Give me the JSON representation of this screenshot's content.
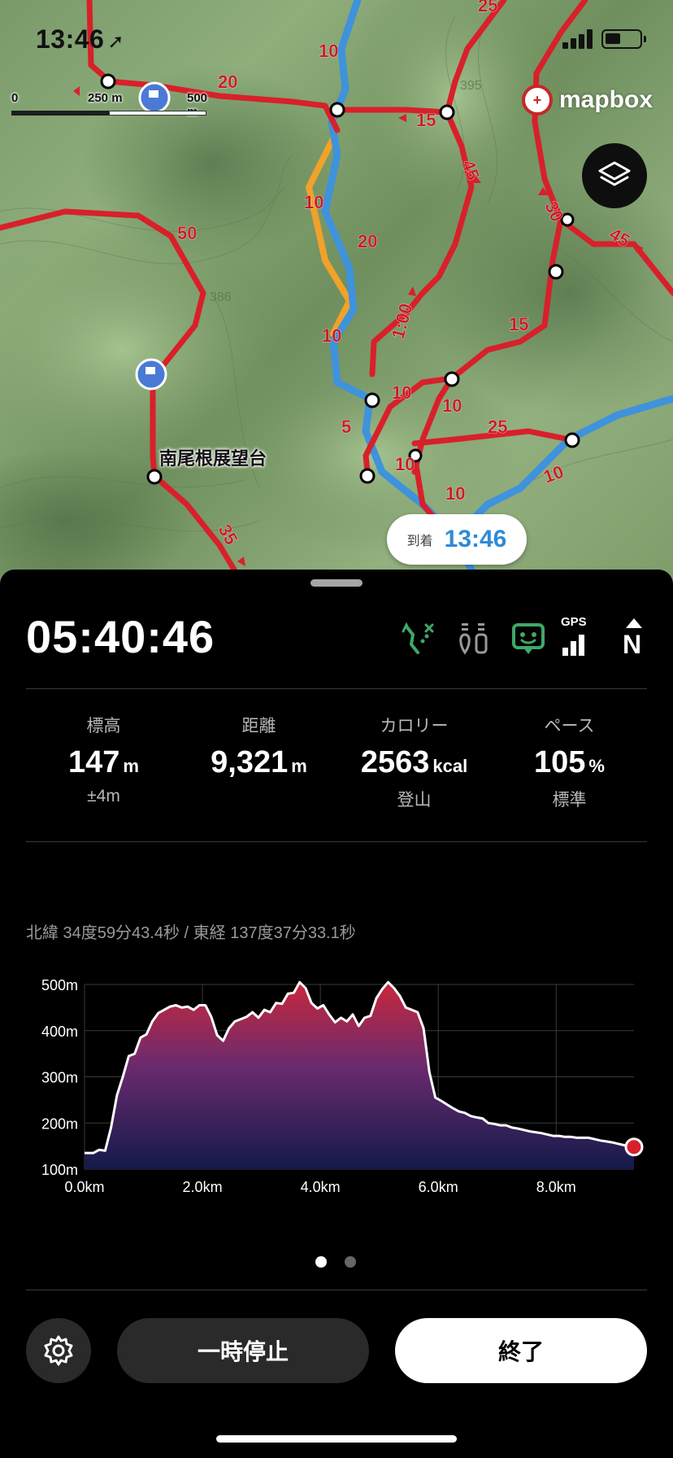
{
  "status_bar": {
    "time": "13:46"
  },
  "map": {
    "scale_labels": [
      "0",
      "250 m",
      "500 m"
    ],
    "brand": "mapbox",
    "place_name": "南尾根展望台",
    "arrival_label": "到着",
    "arrival_time": "13:46",
    "trail_times": [
      "25",
      "10",
      "20",
      "15",
      "45",
      "30",
      "45",
      "50",
      "10",
      "20",
      "1:00",
      "15",
      "10",
      "10",
      "5",
      "25",
      "10",
      "10",
      "10",
      "35",
      "10"
    ],
    "elevation_marks": [
      "395",
      "386"
    ],
    "colors": {
      "trail": "#d8202b",
      "river": "#3f92dc",
      "road": "#f0a22a"
    }
  },
  "panel": {
    "elapsed": "05:40:46",
    "status_icons": [
      "route-icon",
      "trail-markers-icon",
      "map-sync-icon",
      "gps-signal-icon",
      "north-up-icon"
    ],
    "gps_label": "GPS",
    "north_label": "N",
    "stats": [
      {
        "label": "標高",
        "value": "147",
        "unit": "m",
        "sub": "±4m"
      },
      {
        "label": "距離",
        "value": "9,321",
        "unit": "m",
        "sub": ""
      },
      {
        "label": "カロリー",
        "value": "2563",
        "unit": "kcal",
        "sub": "登山"
      },
      {
        "label": "ペース",
        "value": "105",
        "unit": "%",
        "sub": "標準"
      }
    ],
    "coordinates": "北緯 34度59分43.4秒 / 東経 137度37分33.1秒",
    "page_dots": {
      "count": 2,
      "active": 0
    },
    "buttons": {
      "pause": "一時停止",
      "end": "終了"
    }
  },
  "chart_data": {
    "type": "area",
    "xlabel": "",
    "ylabel": "",
    "xlim": [
      0,
      9.32
    ],
    "ylim": [
      100,
      500
    ],
    "x_ticks": [
      "0.0km",
      "2.0km",
      "4.0km",
      "6.0km",
      "8.0km"
    ],
    "y_ticks": [
      "500m",
      "400m",
      "300m",
      "200m",
      "100m"
    ],
    "x_tick_values": [
      0,
      2,
      4,
      6,
      8
    ],
    "y_tick_values": [
      500,
      400,
      300,
      200,
      100
    ],
    "grid": true,
    "series": [
      {
        "x": [
          0,
          0.15,
          0.25,
          0.35,
          0.45,
          0.55,
          0.65,
          0.75,
          0.85,
          0.95,
          1.05,
          1.15,
          1.25,
          1.35,
          1.45,
          1.55,
          1.65,
          1.75,
          1.85,
          1.95,
          2.05,
          2.15,
          2.25,
          2.35,
          2.45,
          2.55,
          2.65,
          2.75,
          2.85,
          2.95,
          3.05,
          3.15,
          3.25,
          3.35,
          3.45,
          3.55,
          3.65,
          3.75,
          3.85,
          3.95,
          4.05,
          4.15,
          4.25,
          4.35,
          4.45,
          4.55,
          4.65,
          4.75,
          4.85,
          4.95,
          5.05,
          5.15,
          5.25,
          5.35,
          5.45,
          5.55,
          5.65,
          5.75,
          5.85,
          5.95,
          6.05,
          6.15,
          6.25,
          6.35,
          6.45,
          6.55,
          6.65,
          6.75,
          6.85,
          6.95,
          7.05,
          7.15,
          7.25,
          7.35,
          7.45,
          7.55,
          7.65,
          7.75,
          7.85,
          7.95,
          8.05,
          8.15,
          8.25,
          8.35,
          8.45,
          8.55,
          8.65,
          8.75,
          8.85,
          8.95,
          9.05,
          9.15,
          9.32
        ],
        "values": [
          135,
          135,
          142,
          140,
          190,
          260,
          300,
          345,
          350,
          385,
          392,
          420,
          438,
          445,
          452,
          455,
          450,
          452,
          445,
          455,
          455,
          430,
          390,
          378,
          405,
          420,
          425,
          430,
          440,
          428,
          445,
          440,
          460,
          458,
          480,
          482,
          505,
          492,
          460,
          448,
          455,
          435,
          418,
          428,
          420,
          435,
          410,
          428,
          432,
          470,
          490,
          505,
          492,
          475,
          450,
          445,
          440,
          405,
          310,
          255,
          248,
          240,
          232,
          225,
          222,
          215,
          212,
          210,
          200,
          198,
          195,
          195,
          190,
          188,
          185,
          182,
          180,
          178,
          175,
          172,
          172,
          170,
          170,
          168,
          168,
          168,
          165,
          162,
          160,
          158,
          155,
          152,
          148
        ],
        "end_marker": {
          "x": 9.32,
          "y": 148
        }
      }
    ]
  }
}
